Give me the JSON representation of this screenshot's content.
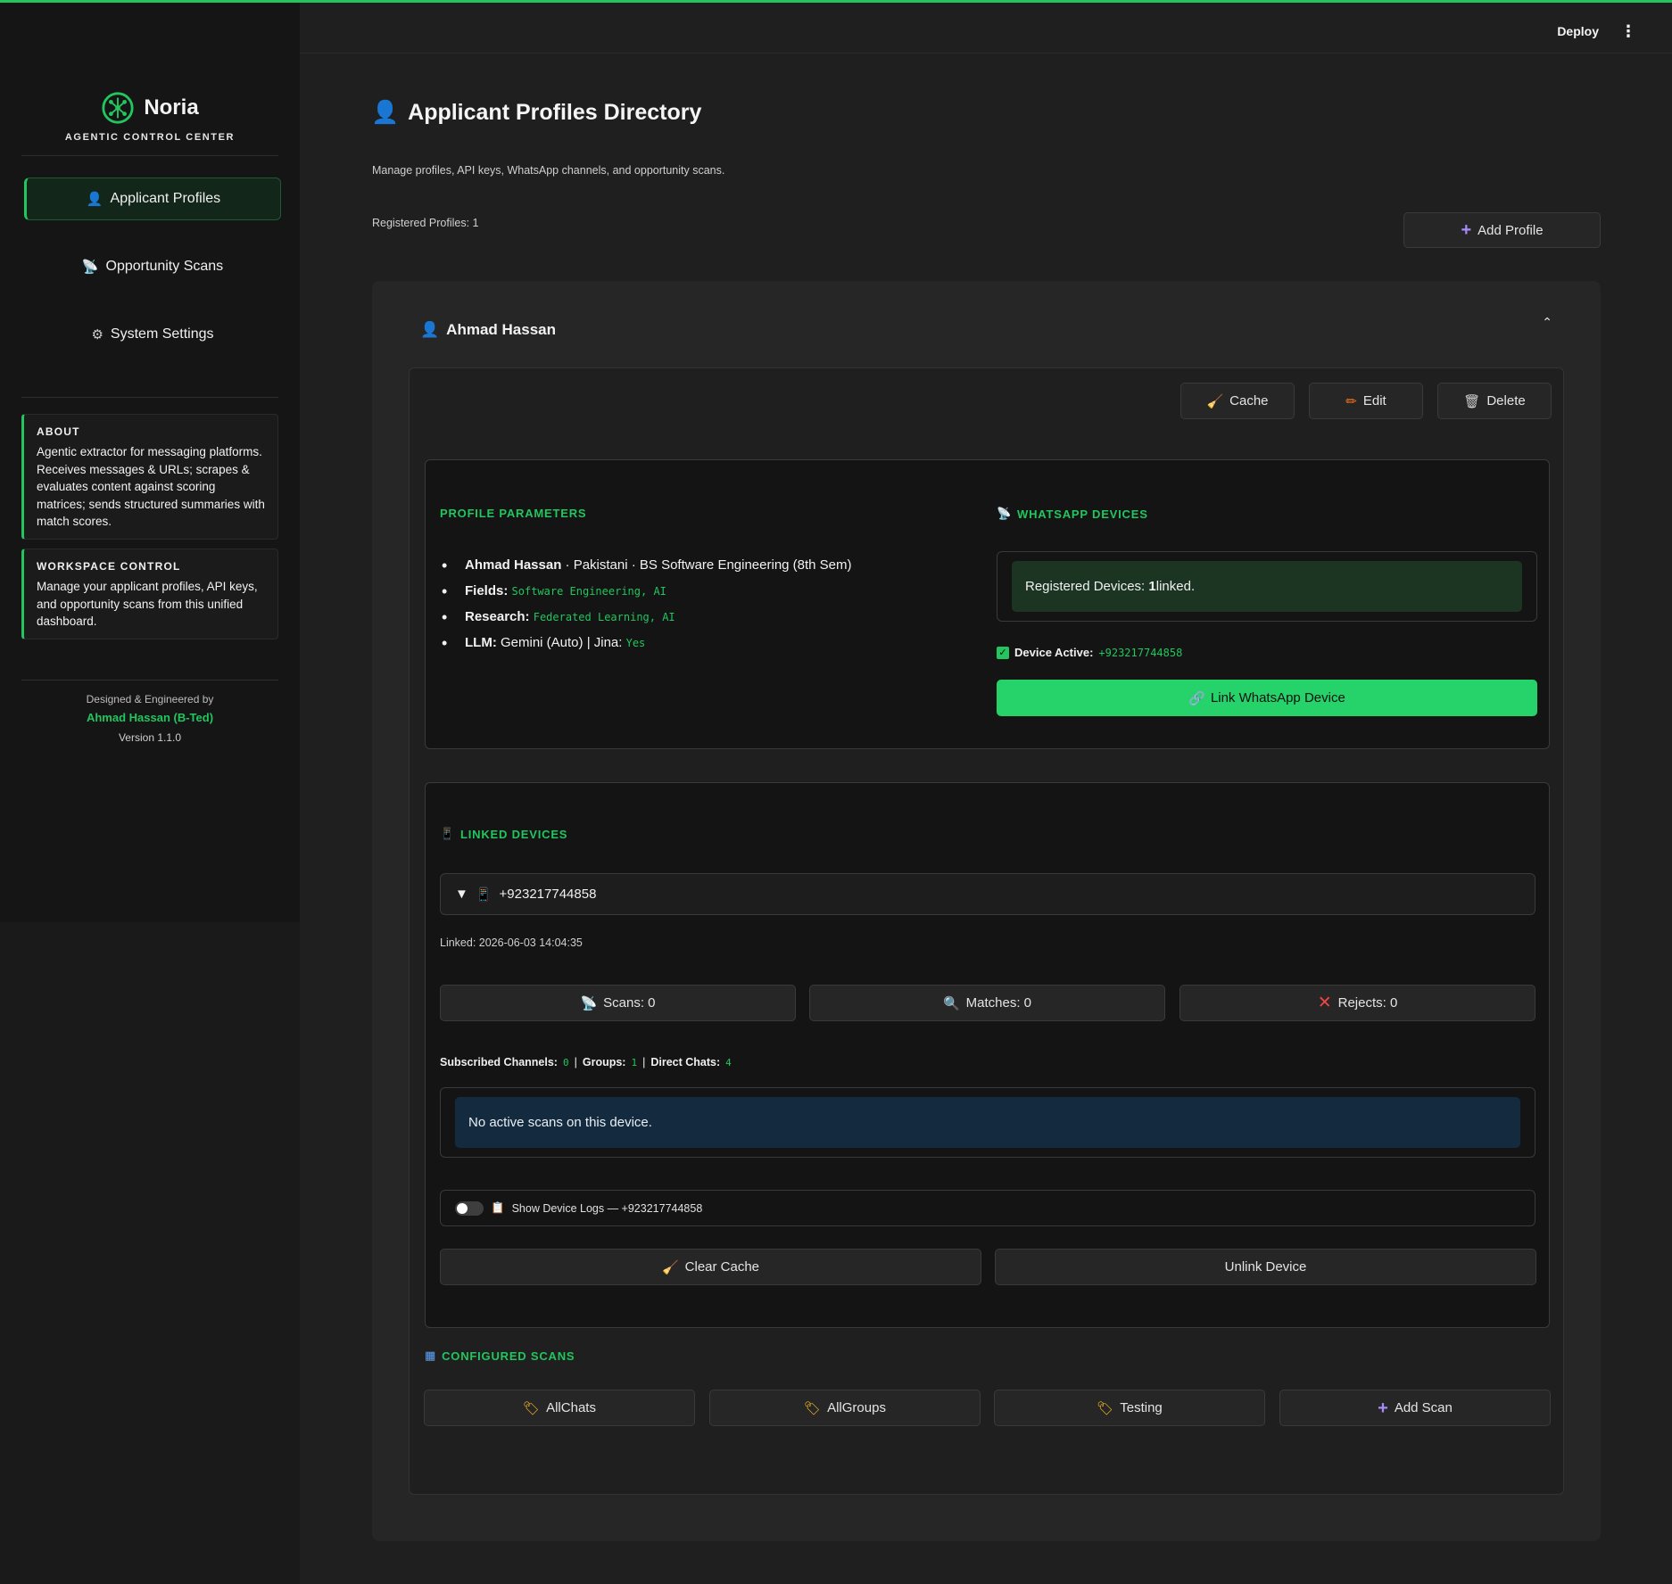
{
  "app": {
    "brand_name": "Noria",
    "brand_subtitle": "AGENTIC CONTROL CENTER",
    "accent_color": "#22c55e"
  },
  "header": {
    "deploy_label": "Deploy",
    "menu_icon": "⋮"
  },
  "sidebar": {
    "nav": [
      {
        "label": "Applicant Profiles",
        "icon": "👤",
        "active": true
      },
      {
        "label": "Opportunity Scans",
        "icon": "📡",
        "active": false
      },
      {
        "label": "System Settings",
        "icon": "⚙",
        "active": false
      }
    ],
    "about": {
      "title": "ABOUT",
      "text": "Agentic extractor for messaging platforms. Receives messages & URLs; scrapes & evaluates content against scoring matrices; sends structured summaries with match scores."
    },
    "workspace": {
      "title": "WORKSPACE CONTROL",
      "text": "Manage your applicant profiles, API keys, and opportunity scans from this unified dashboard."
    },
    "credit": {
      "line1": "Designed & Engineered by",
      "author": "Ahmad Hassan (B-Ted)",
      "version": "Version 1.1.0"
    }
  },
  "main": {
    "title_icon": "👤",
    "title": "Applicant Profiles Directory",
    "subtitle": "Manage profiles, API keys, WhatsApp channels, and opportunity scans.",
    "registered_profiles": "Registered Profiles: 1",
    "add_profile_icon": "+",
    "add_profile_label": "Add Profile"
  },
  "profile": {
    "icon": "👤",
    "name": "Ahmad Hassan",
    "collapse_icon": "⌃",
    "actions": {
      "cache_label": "Cache",
      "edit_label": "Edit",
      "delete_label": "Delete"
    },
    "params": {
      "title": "PROFILE PARAMETERS",
      "name": "Ahmad Hassan",
      "name_detail": " · Pakistani · BS Software Engineering (8th Sem)",
      "fields_label": "Fields:",
      "fields_value": "Software Engineering, AI",
      "research_label": "Research:",
      "research_value": "Federated Learning, AI",
      "llm_label": "LLM:",
      "llm_value": " Gemini (Auto) | Jina: ",
      "jina_value": "Yes"
    },
    "whatsapp": {
      "title": "WHATSAPP DEVICES",
      "registered_prefix": "Registered Devices: ",
      "registered_count": "1",
      "registered_suffix": " linked.",
      "device_active_label": "Device Active:",
      "device_active_number": "+923217744858",
      "link_button_label": "Link WhatsApp Device"
    },
    "linked_devices": {
      "title": "LINKED DEVICES",
      "device_number": "+923217744858",
      "expander_icon": "▼",
      "linked_timestamp": "Linked: 2026-06-03 14:04:35",
      "scans_label": "Scans: 0",
      "matches_label": "Matches: 0",
      "rejects_label": "Rejects: 0",
      "channels_label": "Subscribed Channels:",
      "channels_value": "0",
      "groups_label": "Groups:",
      "groups_value": "1",
      "direct_label": "Direct Chats:",
      "direct_value": "4",
      "no_scans_text": "No active scans on this device.",
      "logs_label": "Show Device Logs — +923217744858",
      "clear_cache_label": "Clear Cache",
      "unlink_label": "Unlink Device"
    },
    "configured_scans": {
      "title": "CONFIGURED SCANS",
      "scans": [
        "AllChats",
        "AllGroups",
        "Testing"
      ],
      "add_scan_label": "Add Scan"
    }
  }
}
